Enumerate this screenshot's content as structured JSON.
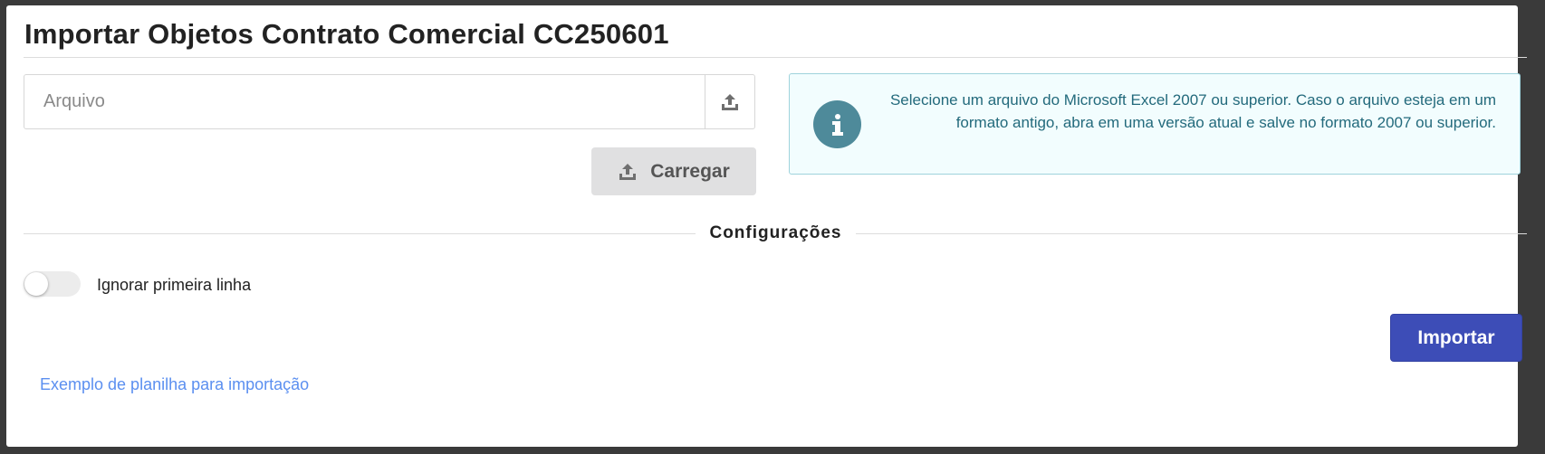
{
  "dialog": {
    "title": "Importar Objetos Contrato Comercial CC250601"
  },
  "file": {
    "placeholder": "Arquivo",
    "value": "",
    "upload_icon": "upload-icon"
  },
  "carregar": {
    "label": "Carregar",
    "icon": "upload-icon"
  },
  "info": {
    "icon": "info-icon",
    "text": "Selecione um arquivo do Microsoft Excel 2007 ou superior. Caso o arquivo esteja em um formato antigo, abra em uma versão atual e salve no formato 2007 ou superior."
  },
  "settings": {
    "section_title": "Configurações",
    "ignore_first_line": {
      "label": "Ignorar primeira linha",
      "checked": false
    }
  },
  "actions": {
    "import_label": "Importar",
    "example_link": "Exemplo de planilha para importação"
  },
  "colors": {
    "primary": "#3d4db7",
    "info_bg": "#f2fdfe",
    "info_border": "#9fd3dc",
    "info_text": "#236a7c",
    "link": "#5b8ff0"
  }
}
